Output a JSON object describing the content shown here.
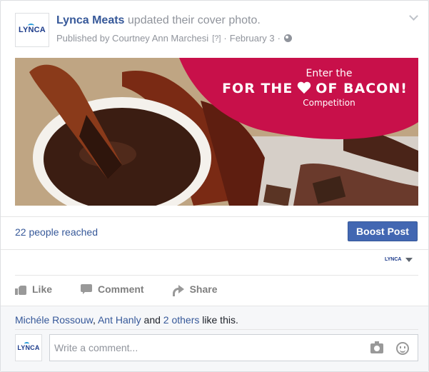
{
  "post": {
    "page_name": "Lynca Meats",
    "action_text": "updated their cover photo.",
    "published_by": "Published by Courtney Ann Marchesi",
    "help_marker": "[?]",
    "separator": "·",
    "date": "February 3",
    "avatar_logo": "LYNCA",
    "icons": [
      "chevron-down-icon",
      "globe-icon"
    ]
  },
  "cover": {
    "line1": "Enter the",
    "line2_left": "FOR THE",
    "line2_right": "OF BACON!",
    "line3": "Competition",
    "banner_color": "#c8104a"
  },
  "reach": {
    "text": "22 people reached",
    "boost_label": "Boost Post",
    "boost_color": "#4267b2"
  },
  "post_as": {
    "logo": "LYNCA"
  },
  "actions": {
    "like": "Like",
    "comment": "Comment",
    "share": "Share"
  },
  "likes": {
    "person1": "Michéle Rossouw",
    "comma": ",",
    "person2": "Ant Hanly",
    "and": "and",
    "others": "2 others",
    "suffix": "like this."
  },
  "comment_box": {
    "placeholder": "Write a comment...",
    "avatar_logo": "LYNCA"
  }
}
